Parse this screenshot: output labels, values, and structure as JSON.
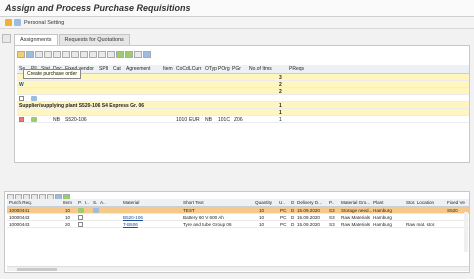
{
  "window": {
    "title": "Assign and Process Purchase Requisitions"
  },
  "toolbar": {
    "personal_setting": "Personal Setting"
  },
  "tabs": [
    {
      "label": "Assignments",
      "active": true
    },
    {
      "label": "Requests for Quotations",
      "active": false
    }
  ],
  "tooltip": "Create purchase order",
  "upper_grid": {
    "headers": [
      "Se..",
      "Pll",
      "Stat",
      "Doc",
      "Fixed vendor",
      "SPII",
      "Cat",
      "Agreement",
      "Item",
      "CoCd",
      "LCurr",
      "OTyp",
      "POrg",
      "PGr",
      "No.of Itms",
      "PReqs"
    ],
    "rows": [
      {
        "kind": "total",
        "cells": {
          "noitms": "3"
        }
      },
      {
        "kind": "subtotal",
        "cells": {
          "noitms": "2"
        }
      },
      {
        "kind": "subtotal",
        "cells": {
          "noitms": "2"
        }
      },
      {
        "kind": "plain",
        "cells": {}
      },
      {
        "kind": "vendor_head",
        "cells": {
          "vendor": "Supplier/supplying plant S520-106 S4 Express Gr. 06",
          "noitms": "1"
        }
      },
      {
        "kind": "vendor_total",
        "cells": {
          "noitms": "1"
        }
      },
      {
        "kind": "item",
        "cells": {
          "doc": "NB",
          "vendor": "S520-106",
          "cocd": "1010",
          "curr": "EUR",
          "otyp": "NB",
          "porg": "101C",
          "pgr": "Z06",
          "noitms": "1"
        }
      }
    ]
  },
  "lower_grid": {
    "headers": [
      "Purch.Req.",
      "Item",
      "P.",
      "I..",
      "S.",
      "A..",
      "Material",
      "Short Text",
      "Quantity",
      "U..",
      "D",
      "Delivery D...",
      "P..",
      "Material Gro...",
      "Plant",
      "Stor. Location",
      "Fixed Ve"
    ],
    "rows": [
      {
        "selected": true,
        "preq": "10000441",
        "item": "10",
        "material": "",
        "short_text": "TEST",
        "qty": "10",
        "unit": "PC",
        "d": "D",
        "deliv": "15.09.2020",
        "p": "S3",
        "mat_group": "Storage need...",
        "plant": "Hamburg",
        "sloc": "",
        "vendor": "S520"
      },
      {
        "selected": false,
        "preq": "10000443",
        "item": "10",
        "material": "B520-106",
        "short_text": "Battery 60 V 600 Ah",
        "qty": "10",
        "unit": "PC",
        "d": "D",
        "deliv": "15.09.2020",
        "p": "S3",
        "mat_group": "Raw Materials",
        "plant": "Hamburg",
        "sloc": "",
        "vendor": ""
      },
      {
        "selected": false,
        "preq": "10000443",
        "item": "20",
        "material": "T-B506",
        "short_text": "Tyre and tube Group 06",
        "qty": "10",
        "unit": "PC",
        "d": "D",
        "deliv": "15.09.2020",
        "p": "S3",
        "mat_group": "Raw Materials",
        "plant": "Hamburg",
        "sloc": "Raw mat. stor.",
        "vendor": ""
      }
    ]
  }
}
